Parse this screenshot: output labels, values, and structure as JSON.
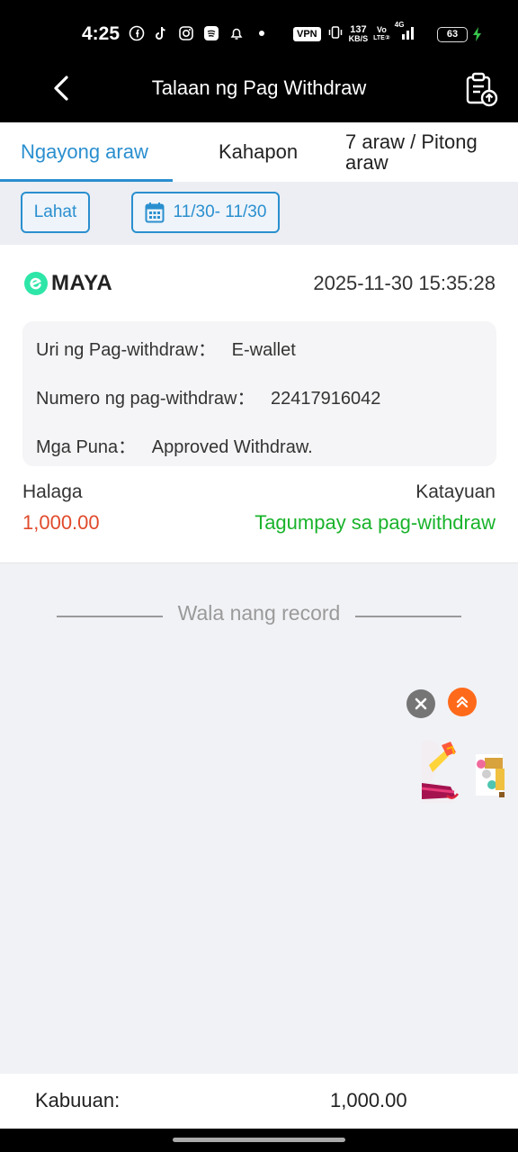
{
  "status_bar": {
    "time": "4:25",
    "vpn": "VPN",
    "speed_value": "137",
    "speed_unit": "KB/S",
    "volte_top": "Vo",
    "volte_bottom": "LTE②",
    "network": "4G",
    "battery": "63",
    "icons": [
      "facebook-icon",
      "tiktok-icon",
      "instagram-icon",
      "spotify-icon",
      "bell-icon",
      "dot-icon",
      "vibrate-icon",
      "signal-icon",
      "charging-icon"
    ]
  },
  "header": {
    "title": "Talaan ng Pag Withdraw",
    "back_icon": "chevron-left-icon",
    "action_icon": "clipboard-upload-icon"
  },
  "tabs": [
    {
      "label": "Ngayong araw",
      "active": true
    },
    {
      "label": "Kahapon",
      "active": false
    },
    {
      "label": "7 araw / Pitong araw",
      "active": false
    }
  ],
  "filters": {
    "all_label": "Lahat",
    "date_range": "11/30- 11/30",
    "date_icon": "calendar-icon"
  },
  "record": {
    "channel": "MAYA",
    "datetime": "2025-11-30 15:35:28",
    "details": [
      {
        "label": "Uri ng Pag-withdraw：",
        "value": "E-wallet"
      },
      {
        "label": "Numero ng pag-withdraw：",
        "value": "22417916042"
      },
      {
        "label": "Mga Puna：",
        "value": "Approved Withdraw."
      }
    ],
    "amount_label": "Halaga",
    "amount": "1,000.00",
    "status_label": "Katayuan",
    "status": "Tagumpay sa pag-withdraw"
  },
  "no_more_text": "Wala nang record",
  "footer": {
    "total_label": "Kabuuan:",
    "total_value": "1,000.00"
  },
  "colors": {
    "accent": "#2a8fcf",
    "amount": "#e04a2b",
    "success": "#19b32b",
    "header_bg": "#000000",
    "page_bg": "#f1f2f6"
  }
}
